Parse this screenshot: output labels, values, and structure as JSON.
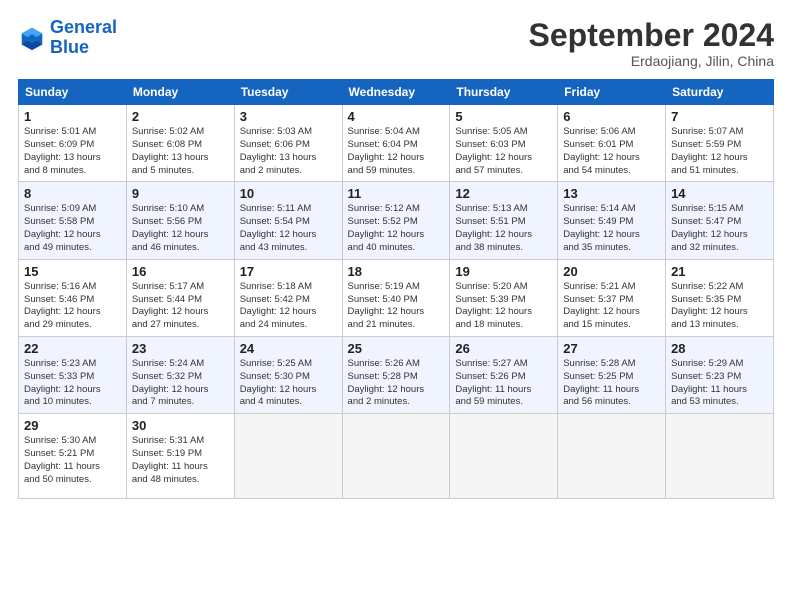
{
  "header": {
    "logo_line1": "General",
    "logo_line2": "Blue",
    "month": "September 2024",
    "location": "Erdaojiang, Jilin, China"
  },
  "days_of_week": [
    "Sunday",
    "Monday",
    "Tuesday",
    "Wednesday",
    "Thursday",
    "Friday",
    "Saturday"
  ],
  "weeks": [
    [
      {
        "day": "1",
        "info": "Sunrise: 5:01 AM\nSunset: 6:09 PM\nDaylight: 13 hours\nand 8 minutes."
      },
      {
        "day": "2",
        "info": "Sunrise: 5:02 AM\nSunset: 6:08 PM\nDaylight: 13 hours\nand 5 minutes."
      },
      {
        "day": "3",
        "info": "Sunrise: 5:03 AM\nSunset: 6:06 PM\nDaylight: 13 hours\nand 2 minutes."
      },
      {
        "day": "4",
        "info": "Sunrise: 5:04 AM\nSunset: 6:04 PM\nDaylight: 12 hours\nand 59 minutes."
      },
      {
        "day": "5",
        "info": "Sunrise: 5:05 AM\nSunset: 6:03 PM\nDaylight: 12 hours\nand 57 minutes."
      },
      {
        "day": "6",
        "info": "Sunrise: 5:06 AM\nSunset: 6:01 PM\nDaylight: 12 hours\nand 54 minutes."
      },
      {
        "day": "7",
        "info": "Sunrise: 5:07 AM\nSunset: 5:59 PM\nDaylight: 12 hours\nand 51 minutes."
      }
    ],
    [
      {
        "day": "8",
        "info": "Sunrise: 5:09 AM\nSunset: 5:58 PM\nDaylight: 12 hours\nand 49 minutes."
      },
      {
        "day": "9",
        "info": "Sunrise: 5:10 AM\nSunset: 5:56 PM\nDaylight: 12 hours\nand 46 minutes."
      },
      {
        "day": "10",
        "info": "Sunrise: 5:11 AM\nSunset: 5:54 PM\nDaylight: 12 hours\nand 43 minutes."
      },
      {
        "day": "11",
        "info": "Sunrise: 5:12 AM\nSunset: 5:52 PM\nDaylight: 12 hours\nand 40 minutes."
      },
      {
        "day": "12",
        "info": "Sunrise: 5:13 AM\nSunset: 5:51 PM\nDaylight: 12 hours\nand 38 minutes."
      },
      {
        "day": "13",
        "info": "Sunrise: 5:14 AM\nSunset: 5:49 PM\nDaylight: 12 hours\nand 35 minutes."
      },
      {
        "day": "14",
        "info": "Sunrise: 5:15 AM\nSunset: 5:47 PM\nDaylight: 12 hours\nand 32 minutes."
      }
    ],
    [
      {
        "day": "15",
        "info": "Sunrise: 5:16 AM\nSunset: 5:46 PM\nDaylight: 12 hours\nand 29 minutes."
      },
      {
        "day": "16",
        "info": "Sunrise: 5:17 AM\nSunset: 5:44 PM\nDaylight: 12 hours\nand 27 minutes."
      },
      {
        "day": "17",
        "info": "Sunrise: 5:18 AM\nSunset: 5:42 PM\nDaylight: 12 hours\nand 24 minutes."
      },
      {
        "day": "18",
        "info": "Sunrise: 5:19 AM\nSunset: 5:40 PM\nDaylight: 12 hours\nand 21 minutes."
      },
      {
        "day": "19",
        "info": "Sunrise: 5:20 AM\nSunset: 5:39 PM\nDaylight: 12 hours\nand 18 minutes."
      },
      {
        "day": "20",
        "info": "Sunrise: 5:21 AM\nSunset: 5:37 PM\nDaylight: 12 hours\nand 15 minutes."
      },
      {
        "day": "21",
        "info": "Sunrise: 5:22 AM\nSunset: 5:35 PM\nDaylight: 12 hours\nand 13 minutes."
      }
    ],
    [
      {
        "day": "22",
        "info": "Sunrise: 5:23 AM\nSunset: 5:33 PM\nDaylight: 12 hours\nand 10 minutes."
      },
      {
        "day": "23",
        "info": "Sunrise: 5:24 AM\nSunset: 5:32 PM\nDaylight: 12 hours\nand 7 minutes."
      },
      {
        "day": "24",
        "info": "Sunrise: 5:25 AM\nSunset: 5:30 PM\nDaylight: 12 hours\nand 4 minutes."
      },
      {
        "day": "25",
        "info": "Sunrise: 5:26 AM\nSunset: 5:28 PM\nDaylight: 12 hours\nand 2 minutes."
      },
      {
        "day": "26",
        "info": "Sunrise: 5:27 AM\nSunset: 5:26 PM\nDaylight: 11 hours\nand 59 minutes."
      },
      {
        "day": "27",
        "info": "Sunrise: 5:28 AM\nSunset: 5:25 PM\nDaylight: 11 hours\nand 56 minutes."
      },
      {
        "day": "28",
        "info": "Sunrise: 5:29 AM\nSunset: 5:23 PM\nDaylight: 11 hours\nand 53 minutes."
      }
    ],
    [
      {
        "day": "29",
        "info": "Sunrise: 5:30 AM\nSunset: 5:21 PM\nDaylight: 11 hours\nand 50 minutes."
      },
      {
        "day": "30",
        "info": "Sunrise: 5:31 AM\nSunset: 5:19 PM\nDaylight: 11 hours\nand 48 minutes."
      },
      {
        "day": "",
        "info": ""
      },
      {
        "day": "",
        "info": ""
      },
      {
        "day": "",
        "info": ""
      },
      {
        "day": "",
        "info": ""
      },
      {
        "day": "",
        "info": ""
      }
    ]
  ]
}
